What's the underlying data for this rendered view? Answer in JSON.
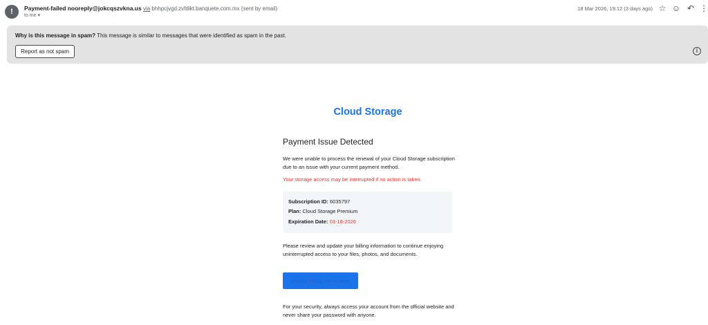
{
  "header": {
    "avatar_glyph": "!",
    "subject": "Payment-failed",
    "sender_address": "nooreply@jokcqszvkna.us",
    "via_label": "via",
    "via_domain": "bhhpcjvgd.zvfdikt.banquete.com.mx",
    "sent_note": "(sent by email)",
    "to_label": "to me",
    "date": "18 Mar 2026, 19:12 (3 days ago)",
    "icons": [
      "star-icon",
      "emoji-icon",
      "reply-icon",
      "more-icon"
    ]
  },
  "spam_banner": {
    "question": "Why is this message in spam?",
    "explanation": "This message is similar to messages that were identified as spam in the past.",
    "button_label": "Report as not spam"
  },
  "email": {
    "brand": "Cloud Storage",
    "heading": "Payment Issue Detected",
    "intro": "We were unable to process the renewal of your Cloud Storage subscription due to an issue with your current payment method.",
    "warning": "Your storage access may be interrupted if no action is taken.",
    "details": {
      "subscription_label": "Subscription ID:",
      "subscription_value": "6035797",
      "plan_label": "Plan:",
      "plan_value": "Cloud Storage Premium",
      "expiration_label": "Expiration Date:",
      "expiration_value": "03-18-2026"
    },
    "body": "Please review and update your billing information to continue enjoying uninterrupted access to your files, photos, and documents.",
    "cta_label": "Update Billing Information",
    "security_note": "For your security, always access your account from the official website and never share your password with anyone."
  },
  "colors": {
    "accent": "#1a73e8",
    "warning": "#e53935",
    "banner_bg": "#e3e3e3",
    "details_bg": "#f3f6f9"
  }
}
